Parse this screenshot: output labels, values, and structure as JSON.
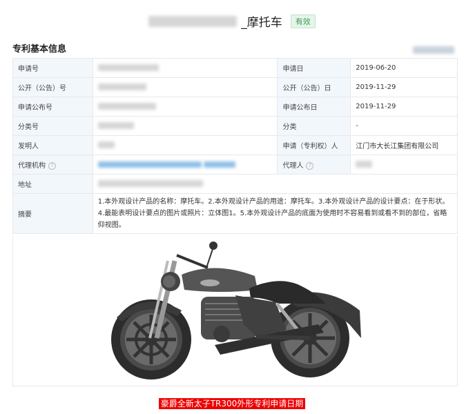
{
  "header": {
    "title": "_摩托车",
    "status": "有效"
  },
  "section": {
    "title": "专利基本信息"
  },
  "rows": {
    "r1": {
      "l1": "申请号",
      "l2": "申请日",
      "v2": "2019-06-20"
    },
    "r2": {
      "l1": "公开（公告）号",
      "l2": "公开（公告）日",
      "v2": "2019-11-29"
    },
    "r3": {
      "l1": "申请公布号",
      "l2": "申请公布日",
      "v2": "2019-11-29"
    },
    "r4": {
      "l1": "分类号",
      "l2": "分类",
      "v2": "-"
    },
    "r5": {
      "l1": "发明人",
      "l2": "申请（专利权）人",
      "v2": "江门市大长江集团有限公司"
    },
    "r6": {
      "l1": "代理机构",
      "l2": "代理人"
    },
    "r7": {
      "l1": "地址"
    },
    "r8": {
      "l1": "摘要",
      "v1": "1.本外观设计产品的名称：摩托车。2.本外观设计产品的用途：摩托车。3.本外观设计产品的设计要点：在于形状。4.最能表明设计要点的图片或照片：立体图1。5.本外观设计产品的底面为使用时不容易看到或看不到的部位，省略仰视图。"
    }
  },
  "icons": {
    "help": "help-circle-icon"
  },
  "caption": "豪爵全新太子TR300外形专利申请日期",
  "colors": {
    "link": "#1a7ad8",
    "label_bg": "#f2f7fc",
    "badge": "#3d9b52",
    "caption_bg": "#ee0000"
  }
}
